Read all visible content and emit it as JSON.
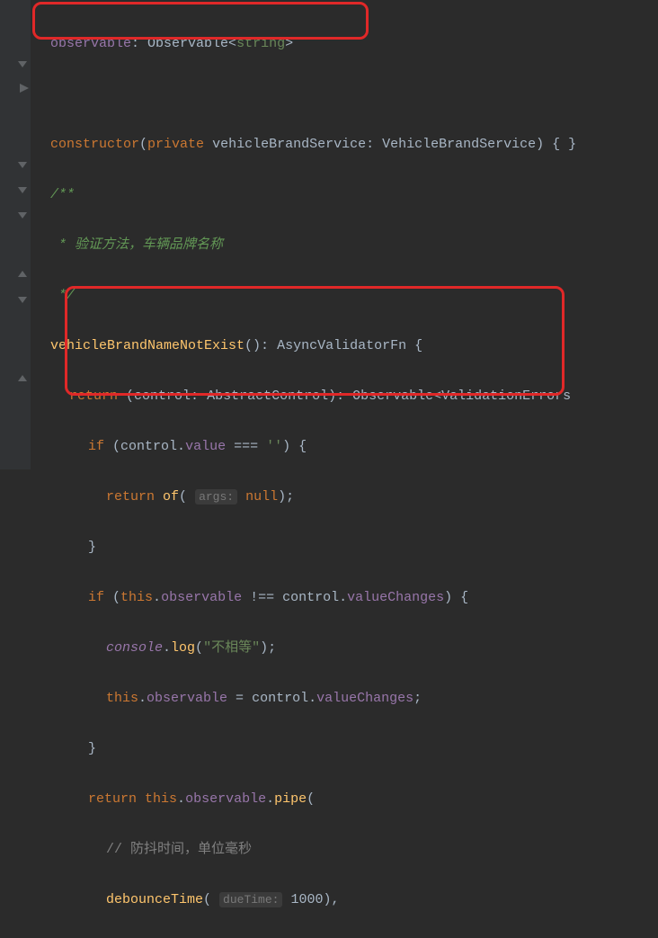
{
  "code": {
    "l1_field": "observable",
    "l1_type": "Observable",
    "l1_generic": "string",
    "l3_kw1": "constructor",
    "l3_kw2": "private",
    "l3_param": "vehicleBrandService",
    "l3_type": "VehicleBrandService",
    "l4": "/**",
    "l5_star": " * ",
    "l5_text": "验证方法，车辆品牌名称",
    "l6": " */",
    "l7_fn": "vehicleBrandNameNotExist",
    "l7_ret": "AsyncValidatorFn",
    "l8_kw": "return",
    "l8_param": "control",
    "l8_ptype": "AbstractControl",
    "l8_ret1": "Observable",
    "l8_ret2": "ValidationErrors",
    "l9_if": "if",
    "l9_ctrl": "control",
    "l9_val": "value",
    "l9_eq": " === ",
    "l9_str": "''",
    "l10_kw": "return",
    "l10_of": "of",
    "l10_hint": "args:",
    "l10_null": "null",
    "l12_if": "if",
    "l12_this": "this",
    "l12_obs": "observable",
    "l12_neq": " !== ",
    "l12_ctrl": "control",
    "l12_vc": "valueChanges",
    "l13_console": "console",
    "l13_log": "log",
    "l13_str": "\"不相等\"",
    "l14_this": "this",
    "l14_obs": "observable",
    "l14_ctrl": "control",
    "l14_vc": "valueChanges",
    "l16_kw": "return",
    "l16_this": "this",
    "l16_obs": "observable",
    "l16_pipe": "pipe",
    "l17_slash": "// ",
    "l17_cmt": "防抖时间，单位毫秒",
    "l18_fn": "debounceTime",
    "l18_hint": "dueTime:",
    "l18_num": "1000"
  }
}
